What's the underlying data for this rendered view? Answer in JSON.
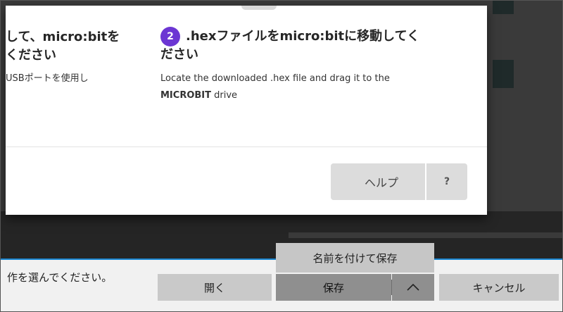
{
  "dialog": {
    "step1": {
      "title_line1": "して、micro:bitを",
      "title_line2": "ください",
      "desc": "USBポートを使用し"
    },
    "step2": {
      "number": "2",
      "title_line1": ".hexファイルをmicro:bitに移動してく",
      "title_line2": "ださい",
      "desc_line1": "Locate the downloaded .hex file and drag it to the",
      "desc_bold": "MICROBIT",
      "desc_tail": " drive"
    },
    "help_label": "ヘルプ",
    "help_question": "?"
  },
  "download_bar": {
    "message": "作を選んでください。",
    "open_label": "開く",
    "save_label": "保存",
    "chevron_icon": "chevron-up-icon",
    "cancel_label": "キャンセル",
    "save_as_label": "名前を付けて保存"
  },
  "colors": {
    "badge": "#6c36d3",
    "accent_line": "#1a86d0"
  }
}
